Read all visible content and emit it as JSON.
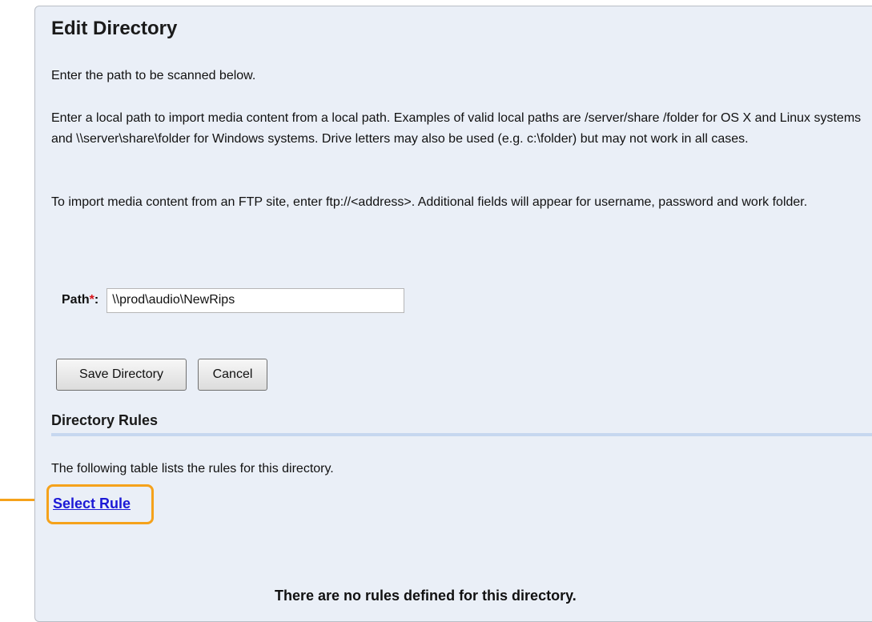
{
  "page": {
    "title": "Edit Directory",
    "intro": "Enter the path to be scanned below.",
    "local_path_help": "Enter a local path to import media content from a local path. Examples of valid local paths are /server/share /folder for OS X and Linux systems and \\\\server\\share\\folder for Windows systems. Drive letters may also be used (e.g. c:\\folder) but may not work in all cases.",
    "ftp_help": "To import media content from an FTP site, enter ftp://<address>. Additional fields will appear for username, password and work folder."
  },
  "path_field": {
    "label": "Path",
    "required_marker": "*",
    "colon": ":",
    "value": "\\\\prod\\audio\\NewRips"
  },
  "buttons": {
    "save_label": "Save Directory",
    "cancel_label": "Cancel"
  },
  "rules_section": {
    "title": "Directory Rules",
    "description": "The following table lists the rules for this directory.",
    "select_rule_label": "Select Rule",
    "empty_message": "There are no rules defined for this directory."
  },
  "colors": {
    "panel_bg": "#eaeff7",
    "link": "#1c19d6",
    "highlight": "#f5a21b",
    "required": "#d8141a"
  }
}
